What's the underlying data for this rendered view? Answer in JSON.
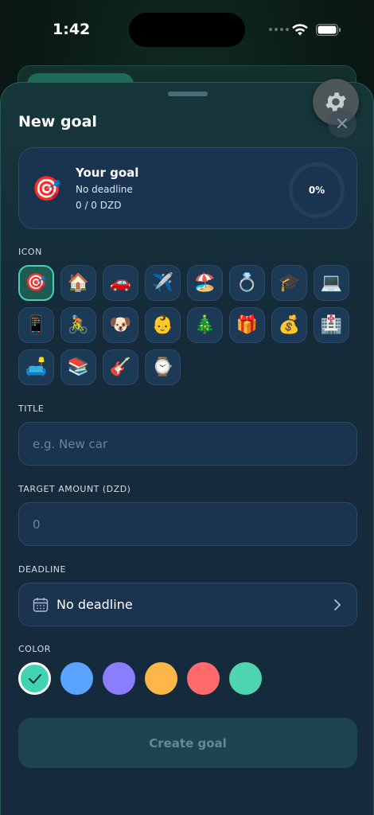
{
  "status_bar": {
    "time": "1:42"
  },
  "sheet": {
    "title": "New goal"
  },
  "preview": {
    "icon": "🎯",
    "name": "Your goal",
    "deadline": "No deadline",
    "amount": "0 / 0 DZD",
    "progress": "0%"
  },
  "icon_section": {
    "label": "ICON",
    "icons": [
      "🎯",
      "🏠",
      "🚗",
      "✈️",
      "🏖️",
      "💍",
      "🎓",
      "💻",
      "📱",
      "🚴",
      "🐶",
      "👶",
      "🎄",
      "🎁",
      "💰",
      "🏥",
      "🛋️",
      "📚",
      "🎸",
      "⌚"
    ],
    "selected_index": 0
  },
  "title_field": {
    "label": "TITLE",
    "placeholder": "e.g. New car"
  },
  "amount_field": {
    "label": "TARGET AMOUNT (DZD)",
    "placeholder": "0"
  },
  "deadline_field": {
    "label": "DEADLINE",
    "value": "No deadline"
  },
  "color_section": {
    "label": "COLOR",
    "colors": [
      "#3fd3b2",
      "#5aa4ff",
      "#8b7dff",
      "#ffb648",
      "#ff6b6b",
      "#4ed4b0"
    ],
    "selected_index": 0
  },
  "create_button": {
    "label": "Create goal"
  }
}
